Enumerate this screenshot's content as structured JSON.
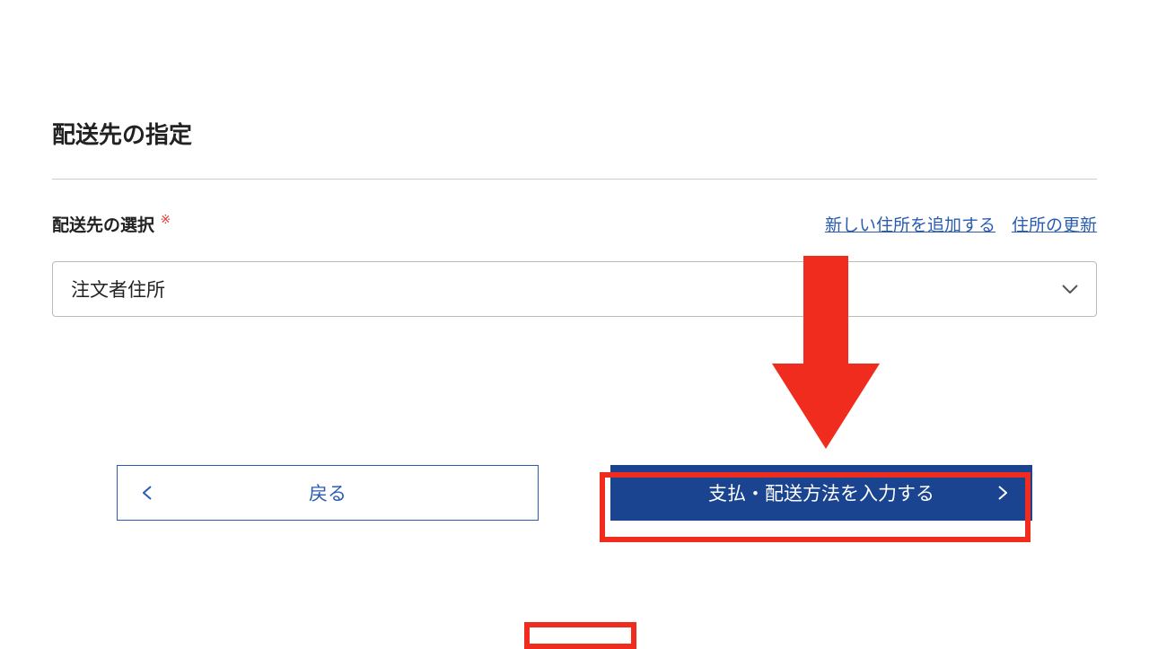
{
  "section": {
    "title": "配送先の指定"
  },
  "field": {
    "label": "配送先の選択",
    "required_mark": "※"
  },
  "links": {
    "add_address": "新しい住所を追加する",
    "update_address": "住所の更新"
  },
  "select": {
    "value": "注文者住所"
  },
  "buttons": {
    "back": "戻る",
    "next": "支払・配送方法を入力する"
  },
  "annotation": {
    "arrow_color": "#f02c1f",
    "highlight_color": "#f02c1f"
  }
}
